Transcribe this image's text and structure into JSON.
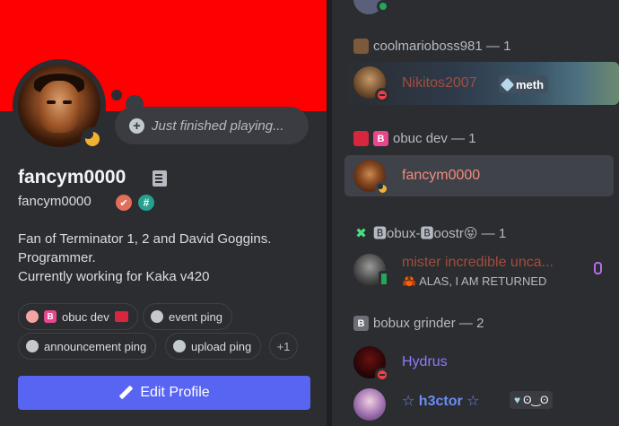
{
  "profile": {
    "thought": "Just finished playing...",
    "display_name": "fancym0000",
    "username": "fancym0000",
    "badge_1": "✔",
    "badge_2": "#",
    "bio": [
      "Fan of Terminator 1, 2 and David Goggins.",
      "Programmer.",
      "Currently working for Kaka v420"
    ],
    "roles": [
      {
        "label": "obuc dev",
        "prefix": "B"
      },
      {
        "label": "event ping"
      },
      {
        "label": "announcement ping"
      },
      {
        "label": "upload ping"
      }
    ],
    "more_roles": "+1",
    "edit_button": "Edit Profile"
  },
  "members": {
    "groups": [
      {
        "header": "coolmarioboss981 — 1"
      },
      {
        "header": "obuc dev — 1",
        "icon_letter": "B"
      },
      {
        "header": "🅱obux-🅱oostr😝 — 1"
      },
      {
        "header": "bobux grinder — 2",
        "icon_letter": "B"
      }
    ],
    "items": [
      {
        "name": "Nikitos2007",
        "tag": "meth",
        "color": "#a34d3c"
      },
      {
        "name": "fancym0000",
        "color": "#f28b7e"
      },
      {
        "name": "mister incredible unca...",
        "sub": "🦀 ALAS, I AM RETURNED",
        "color": "#a34d3c"
      },
      {
        "name": "Hydrus",
        "color": "#8a7cf7"
      },
      {
        "name": "☆ h3ctor ☆",
        "tag": "ʘ‿ʘ",
        "color": "#6d8cf5"
      }
    ]
  },
  "colors": {
    "banner": "#fe0001",
    "accent": "#5865f2",
    "background": "#2b2d31",
    "idle": "#f0b232",
    "dnd": "#f23f43"
  }
}
